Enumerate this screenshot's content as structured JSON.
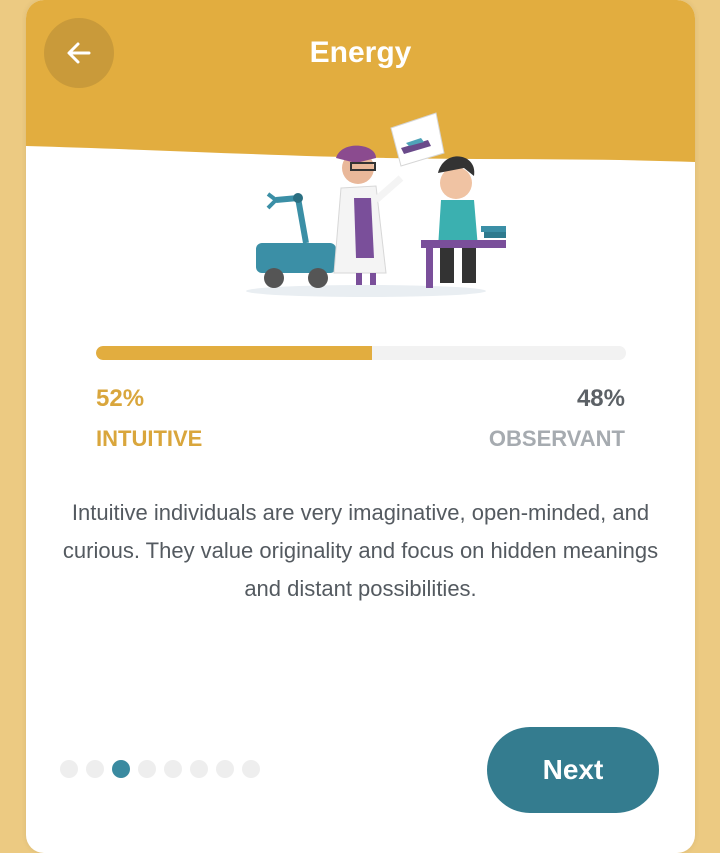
{
  "header": {
    "title": "Energy",
    "back_icon": "arrow-left-icon",
    "accent_color": "#e2ad3f"
  },
  "illustration": {
    "icon": "scientists-illustration-icon"
  },
  "trait": {
    "left_percent": "52%",
    "left_label": "INTUITIVE",
    "right_percent": "48%",
    "right_label": "OBSERVANT",
    "left_fraction": 0.52
  },
  "description": "Intuitive individuals are very imaginative, open-minded, and curious. They value originality and focus on hidden meanings and distant possibilities.",
  "pagination": {
    "total": 8,
    "active_index": 2,
    "active_color": "#3a8aa0"
  },
  "next_button": {
    "label": "Next",
    "color": "#347c8f"
  }
}
